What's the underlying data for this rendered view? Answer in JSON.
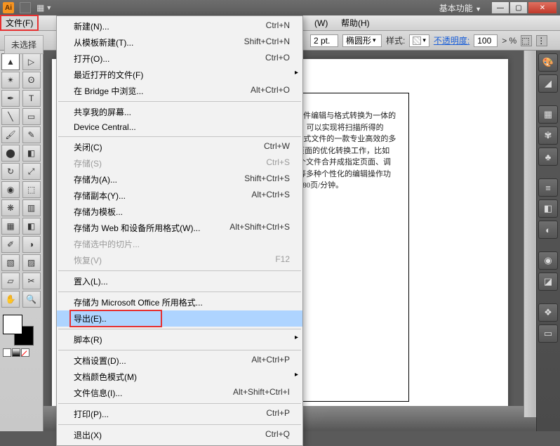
{
  "titlebar": {
    "workspace": "基本功能",
    "logo": "Ai"
  },
  "menubar": {
    "file": "文件(F)",
    "window": "(W)",
    "help": "帮助(H)"
  },
  "options": {
    "noselect": "未选择",
    "stroke_val": "2 pt.",
    "shape": "椭圆形",
    "style_label": "样式:",
    "opacity_label": "不透明度:",
    "opacity_val": "100",
    "opacity_unit": "> %"
  },
  "doc_text": "都叫兽™PDF转换，是一款集PDF文件编辑与格式转换为一体的多的OCR（光学文字符识别）技术，可以实现将扫描所得的PDF格式Image/HTML/TXT等常见格式文件的一款专业高效的多格式转换工成对PDF格式文件特定页面的优化转换工作，比如修复损坏文件、文件的分割、将多个文件合并成指定页面、调整文件显示角度、加加多形式水印等多种个性化的编辑操作功能。同时还可以完成对P速度可高达80页/分钟。",
  "menu": {
    "items": [
      {
        "label": "新建(N)...",
        "short": "Ctrl+N",
        "type": "item"
      },
      {
        "label": "从模板新建(T)...",
        "short": "Shift+Ctrl+N",
        "type": "item"
      },
      {
        "label": "打开(O)...",
        "short": "Ctrl+O",
        "type": "item"
      },
      {
        "label": "最近打开的文件(F)",
        "short": "",
        "type": "sub"
      },
      {
        "label": "在 Bridge 中浏览...",
        "short": "Alt+Ctrl+O",
        "type": "item"
      },
      {
        "type": "sep"
      },
      {
        "label": "共享我的屏幕...",
        "short": "",
        "type": "item"
      },
      {
        "label": "Device Central...",
        "short": "",
        "type": "item"
      },
      {
        "type": "sep"
      },
      {
        "label": "关闭(C)",
        "short": "Ctrl+W",
        "type": "item"
      },
      {
        "label": "存储(S)",
        "short": "Ctrl+S",
        "type": "disabled"
      },
      {
        "label": "存储为(A)...",
        "short": "Shift+Ctrl+S",
        "type": "item"
      },
      {
        "label": "存储副本(Y)...",
        "short": "Alt+Ctrl+S",
        "type": "item"
      },
      {
        "label": "存储为模板...",
        "short": "",
        "type": "item"
      },
      {
        "label": "存储为 Web 和设备所用格式(W)...",
        "short": "Alt+Shift+Ctrl+S",
        "type": "item"
      },
      {
        "label": "存储选中的切片...",
        "short": "",
        "type": "disabled"
      },
      {
        "label": "恢复(V)",
        "short": "F12",
        "type": "disabled"
      },
      {
        "type": "sep"
      },
      {
        "label": "置入(L)...",
        "short": "",
        "type": "item"
      },
      {
        "type": "sep"
      },
      {
        "label": "存储为 Microsoft Office 所用格式...",
        "short": "",
        "type": "item"
      },
      {
        "label": "导出(E)..",
        "short": "",
        "type": "highlighted-boxed"
      },
      {
        "type": "sep"
      },
      {
        "label": "脚本(R)",
        "short": "",
        "type": "sub"
      },
      {
        "type": "sep"
      },
      {
        "label": "文档设置(D)...",
        "short": "Alt+Ctrl+P",
        "type": "item"
      },
      {
        "label": "文档颜色模式(M)",
        "short": "",
        "type": "sub"
      },
      {
        "label": "文件信息(I)...",
        "short": "Alt+Shift+Ctrl+I",
        "type": "item"
      },
      {
        "type": "sep"
      },
      {
        "label": "打印(P)...",
        "short": "Ctrl+P",
        "type": "item"
      },
      {
        "type": "sep"
      },
      {
        "label": "退出(X)",
        "short": "Ctrl+Q",
        "type": "item"
      }
    ]
  }
}
